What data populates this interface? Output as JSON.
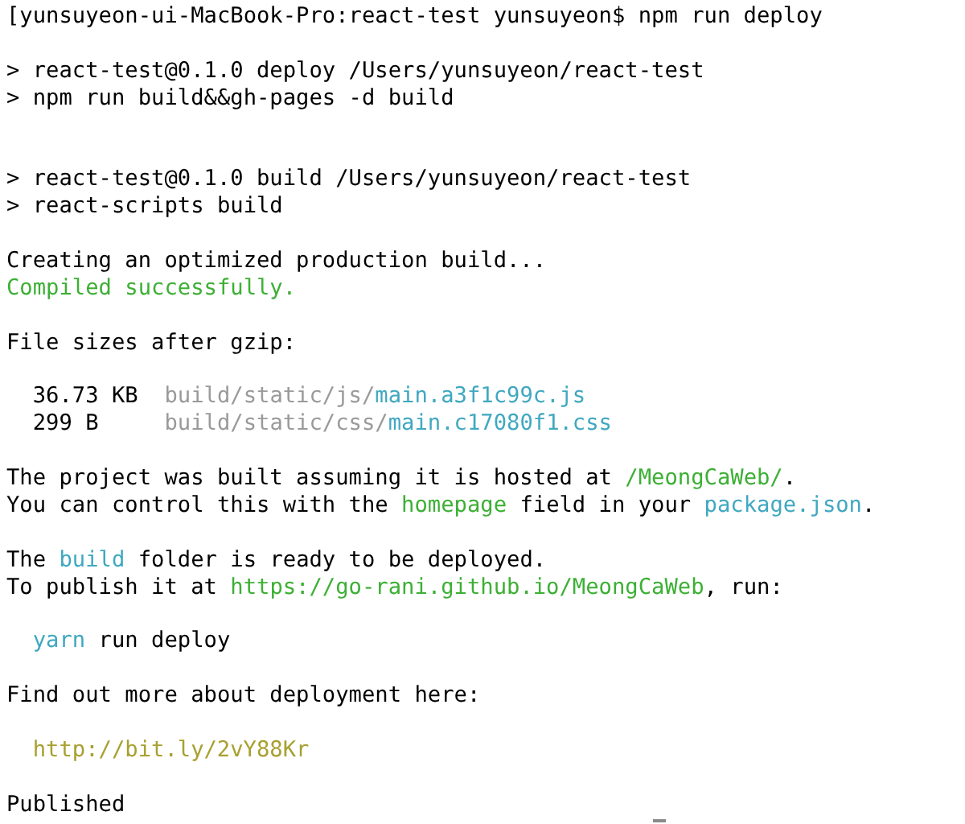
{
  "terminal": {
    "lines": [
      {
        "kind": "text",
        "segments": [
          {
            "text": "[yunsuyeon-ui-MacBook-Pro:react-test yunsuyeon$ npm run deploy",
            "color": "#000000"
          }
        ]
      },
      {
        "kind": "blank"
      },
      {
        "kind": "text",
        "segments": [
          {
            "text": "> react-test@0.1.0 deploy /Users/yunsuyeon/react-test",
            "color": "#000000"
          }
        ]
      },
      {
        "kind": "text",
        "segments": [
          {
            "text": "> npm run build&&gh-pages -d build",
            "color": "#000000"
          }
        ]
      },
      {
        "kind": "blank"
      },
      {
        "kind": "blank"
      },
      {
        "kind": "text",
        "segments": [
          {
            "text": "> react-test@0.1.0 build /Users/yunsuyeon/react-test",
            "color": "#000000"
          }
        ]
      },
      {
        "kind": "text",
        "segments": [
          {
            "text": "> react-scripts build",
            "color": "#000000"
          }
        ]
      },
      {
        "kind": "blank"
      },
      {
        "kind": "text",
        "segments": [
          {
            "text": "Creating an optimized production build...",
            "color": "#000000"
          }
        ]
      },
      {
        "kind": "text",
        "segments": [
          {
            "text": "Compiled successfully.",
            "color": "#3cb034"
          }
        ]
      },
      {
        "kind": "blank"
      },
      {
        "kind": "text",
        "segments": [
          {
            "text": "File sizes after gzip:",
            "color": "#000000"
          }
        ]
      },
      {
        "kind": "blank"
      },
      {
        "kind": "text",
        "segments": [
          {
            "text": "  36.73 KB  ",
            "color": "#000000"
          },
          {
            "text": "build/static/js/",
            "color": "#9a9a9a"
          },
          {
            "text": "main.a3f1c99c.js",
            "color": "#40a8c0"
          }
        ]
      },
      {
        "kind": "text",
        "segments": [
          {
            "text": "  299 B     ",
            "color": "#000000"
          },
          {
            "text": "build/static/css/",
            "color": "#9a9a9a"
          },
          {
            "text": "main.c17080f1.css",
            "color": "#40a8c0"
          }
        ]
      },
      {
        "kind": "blank"
      },
      {
        "kind": "text",
        "segments": [
          {
            "text": "The project was built assuming it is hosted at ",
            "color": "#000000"
          },
          {
            "text": "/MeongCaWeb/",
            "color": "#3cb034"
          },
          {
            "text": ".",
            "color": "#000000"
          }
        ]
      },
      {
        "kind": "text",
        "segments": [
          {
            "text": "You can control this with the ",
            "color": "#000000"
          },
          {
            "text": "homepage",
            "color": "#3cb034"
          },
          {
            "text": " field in your ",
            "color": "#000000"
          },
          {
            "text": "package.json",
            "color": "#40a8c0"
          },
          {
            "text": ".",
            "color": "#000000"
          }
        ]
      },
      {
        "kind": "blank"
      },
      {
        "kind": "text",
        "segments": [
          {
            "text": "The ",
            "color": "#000000"
          },
          {
            "text": "build",
            "color": "#40a8c0"
          },
          {
            "text": " folder is ready to be deployed.",
            "color": "#000000"
          }
        ]
      },
      {
        "kind": "text",
        "segments": [
          {
            "text": "To publish it at ",
            "color": "#000000"
          },
          {
            "text": "https://go-rani.github.io/MeongCaWeb",
            "color": "#3cb034"
          },
          {
            "text": ", run:",
            "color": "#000000"
          }
        ]
      },
      {
        "kind": "blank"
      },
      {
        "kind": "text",
        "indented": true,
        "segments": [
          {
            "text": "yarn",
            "color": "#40a8c0"
          },
          {
            "text": " run deploy",
            "color": "#000000"
          }
        ]
      },
      {
        "kind": "blank"
      },
      {
        "kind": "text",
        "segments": [
          {
            "text": "Find out more about deployment here:",
            "color": "#000000"
          }
        ]
      },
      {
        "kind": "blank"
      },
      {
        "kind": "text",
        "indented": true,
        "segments": [
          {
            "text": "http://bit.ly/2vY88Kr",
            "color": "#a8a030"
          }
        ]
      },
      {
        "kind": "blank"
      },
      {
        "kind": "text",
        "segments": [
          {
            "text": "Published",
            "color": "#000000"
          }
        ]
      }
    ]
  }
}
